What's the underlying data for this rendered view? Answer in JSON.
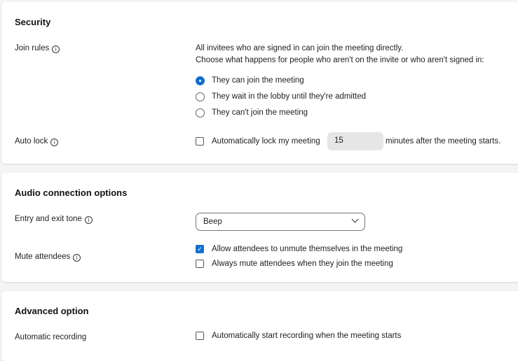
{
  "security": {
    "title": "Security",
    "join_rules_label": "Join rules",
    "join_desc1": "All invitees who are signed in can join the meeting directly.",
    "join_desc2": "Choose what happens for people who aren't on the invite or who aren't signed in:",
    "options": [
      {
        "label": "They can join the meeting",
        "selected": true
      },
      {
        "label": "They wait in the lobby until they're admitted",
        "selected": false
      },
      {
        "label": "They can't join the meeting",
        "selected": false
      }
    ],
    "auto_lock_label": "Auto lock",
    "auto_lock_checkbox": "Automatically lock my meeting",
    "auto_lock_checked": false,
    "auto_lock_minutes": "15",
    "auto_lock_suffix": "minutes after the meeting starts."
  },
  "audio": {
    "title": "Audio connection options",
    "tone_label": "Entry and exit tone",
    "tone_value": "Beep",
    "mute_label": "Mute attendees",
    "allow_unmute": "Allow attendees to unmute themselves in the meeting",
    "allow_unmute_checked": true,
    "always_mute": "Always mute attendees when they join the meeting",
    "always_mute_checked": false
  },
  "advanced": {
    "title": "Advanced option",
    "recording_label": "Automatic recording",
    "recording_checkbox": "Automatically start recording when the meeting starts",
    "recording_checked": false
  },
  "info_icon": "i",
  "accent": "#1170cf"
}
